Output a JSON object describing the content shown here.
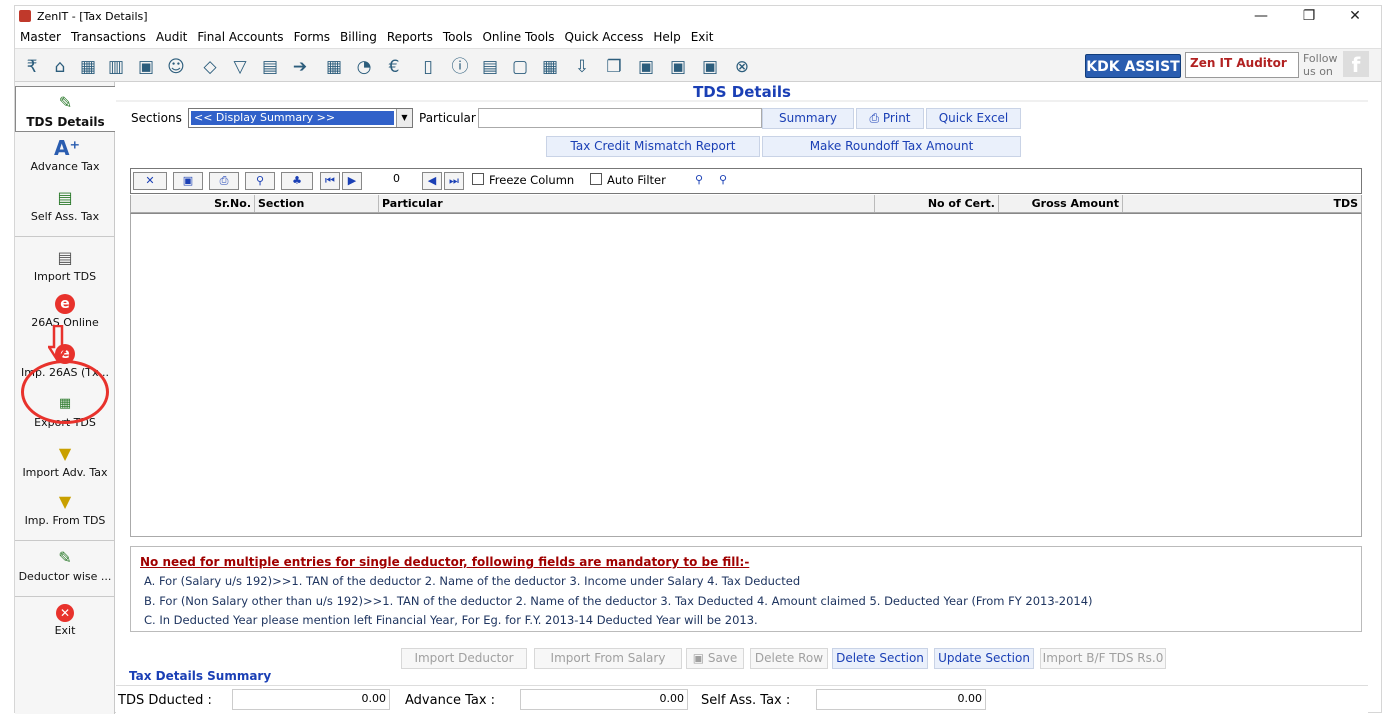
{
  "window": {
    "title": "ZenIT - [Tax Details]",
    "controls": [
      "—",
      "❐",
      "✕"
    ]
  },
  "menu": [
    "Master",
    "Transactions",
    "Audit",
    "Final Accounts",
    "Forms",
    "Billing",
    "Reports",
    "Tools",
    "Online Tools",
    "Quick Access",
    "Help",
    "Exit"
  ],
  "toolbar": {
    "icons": [
      "rupee-icon",
      "home-icon",
      "building-icon",
      "bar-chart-icon",
      "gift-icon",
      "users-icon",
      "tag-icon",
      "filter-icon",
      "tax-icon",
      "arrow-right-icon",
      "calculator-icon",
      "pie-chart-icon",
      "pay-icon",
      "book-icon",
      "info-icon",
      "report-icon",
      "person-doc-icon",
      "calendar-icon",
      "download-icon",
      "copy-icon",
      "bs-icon",
      "bs-sch-icon",
      "3cd-icon",
      "close-circle-icon"
    ],
    "kdk_label": "KDK ASSIST",
    "product_label": "Zen IT Auditor",
    "follow_line1": "Follow",
    "follow_line2": "us on"
  },
  "sidebar": {
    "items": [
      {
        "label": "TDS Details",
        "icon": "tax-icon"
      },
      {
        "label": "Advance Tax",
        "icon": "a-plus-icon"
      },
      {
        "label": "Self Ass. Tax",
        "icon": "document-add-icon"
      },
      {
        "label": "Import TDS",
        "icon": "import-icon"
      },
      {
        "label": "26AS Online",
        "icon": "e-icon"
      },
      {
        "label": "Imp. 26AS (Tx...",
        "icon": "e-icon"
      },
      {
        "label": "Export TDS",
        "icon": "excel-icon"
      },
      {
        "label": "Import Adv. Tax",
        "icon": "folder-import-icon"
      },
      {
        "label": "Imp. From TDS",
        "icon": "folder-import-icon"
      },
      {
        "label": "Deductor wise ...",
        "icon": "tax-icon"
      },
      {
        "label": "Exit",
        "icon": "exit-icon"
      }
    ]
  },
  "page": {
    "title": "TDS Details",
    "sections_label": "Sections",
    "sections_value": "<< Display Summary >>",
    "particular_label": "Particular",
    "particular_value": "",
    "buttons": {
      "summary": "Summary",
      "print": "Print",
      "quick_excel": "Quick Excel",
      "tax_credit": "Tax Credit Mismatch Report",
      "roundoff": "Make Roundoff Tax Amount"
    }
  },
  "grid": {
    "page_number": "0",
    "freeze_label": "Freeze Column",
    "autofilter_label": "Auto Filter",
    "columns": [
      "Sr.No.",
      "Section",
      "Particular",
      "No of Cert.",
      "Gross Amount",
      "TDS"
    ],
    "rows": []
  },
  "note": {
    "title": "No need for multiple entries for single deductor, following fields are mandatory to be fill:-",
    "lines": [
      "A. For (Salary u/s 192)>>1. TAN of the deductor 2. Name of the deductor 3. Income under Salary 4. Tax Deducted",
      "B. For (Non Salary other than u/s 192)>>1. TAN of the deductor 2. Name of the deductor 3. Tax Deducted 4. Amount claimed 5. Deducted Year (From FY 2013-2014)",
      "C. In Deducted Year please mention left Financial Year, For Eg. for F.Y. 2013-14 Deducted Year will be 2013."
    ]
  },
  "actions": {
    "import_deductor": "Import Deductor",
    "import_salary": "Import From Salary",
    "save": "Save",
    "delete_row": "Delete Row",
    "delete_section": "Delete Section",
    "update_section": "Update Section",
    "import_bf": "Import B/F TDS Rs.0"
  },
  "summary": {
    "title": "Tax Details Summary",
    "tds_label": "TDS Dducted :",
    "tds_value": "0.00",
    "adv_label": "Advance Tax :",
    "adv_value": "0.00",
    "self_label": "Self Ass. Tax :",
    "self_value": "0.00"
  },
  "colors": {
    "accent": "#1a3fb5",
    "note_title": "#a00000",
    "annotation": "#e8322c",
    "kdk": "#2a5db0"
  }
}
